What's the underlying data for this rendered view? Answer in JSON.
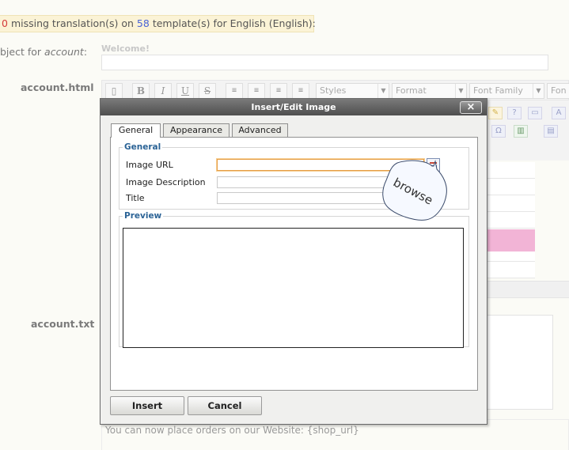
{
  "notice": {
    "count_missing": "0",
    "text_missing": "missing translation(s) on",
    "count_templates": "58",
    "text_templates": "template(s) for English (English):"
  },
  "form": {
    "subject_label_prefix": "bject for",
    "subject_label_em": "account",
    "subject_label_suffix": ":",
    "subject_value": "Welcome!",
    "html_label": "account.html",
    "txt_label": "account.txt",
    "txt_footer": "You can now place orders on our Website: {shop_url}"
  },
  "toolbar": {
    "bold": "B",
    "italic": "I",
    "underline": "U",
    "strike": "S",
    "styles": "Styles",
    "format": "Format",
    "font_family": "Font Family",
    "font_size_partial": "Fon"
  },
  "dialog": {
    "title": "Insert/Edit Image",
    "close": "×",
    "tabs": [
      {
        "label": "General",
        "active": true
      },
      {
        "label": "Appearance",
        "active": false
      },
      {
        "label": "Advanced",
        "active": false
      }
    ],
    "general_legend": "General",
    "fields": {
      "image_url": {
        "label": "Image URL",
        "value": ""
      },
      "image_description": {
        "label": "Image Description",
        "value": ""
      },
      "title": {
        "label": "Title",
        "value": ""
      }
    },
    "preview_legend": "Preview",
    "insert": "Insert",
    "cancel": "Cancel"
  },
  "callout": {
    "text": "browse"
  },
  "colors": {
    "legend_blue": "#2b6396",
    "focus_orange": "#e59d45",
    "notice_bg": "#fbf3d6",
    "highlight_pink": "#f2b4d6"
  }
}
